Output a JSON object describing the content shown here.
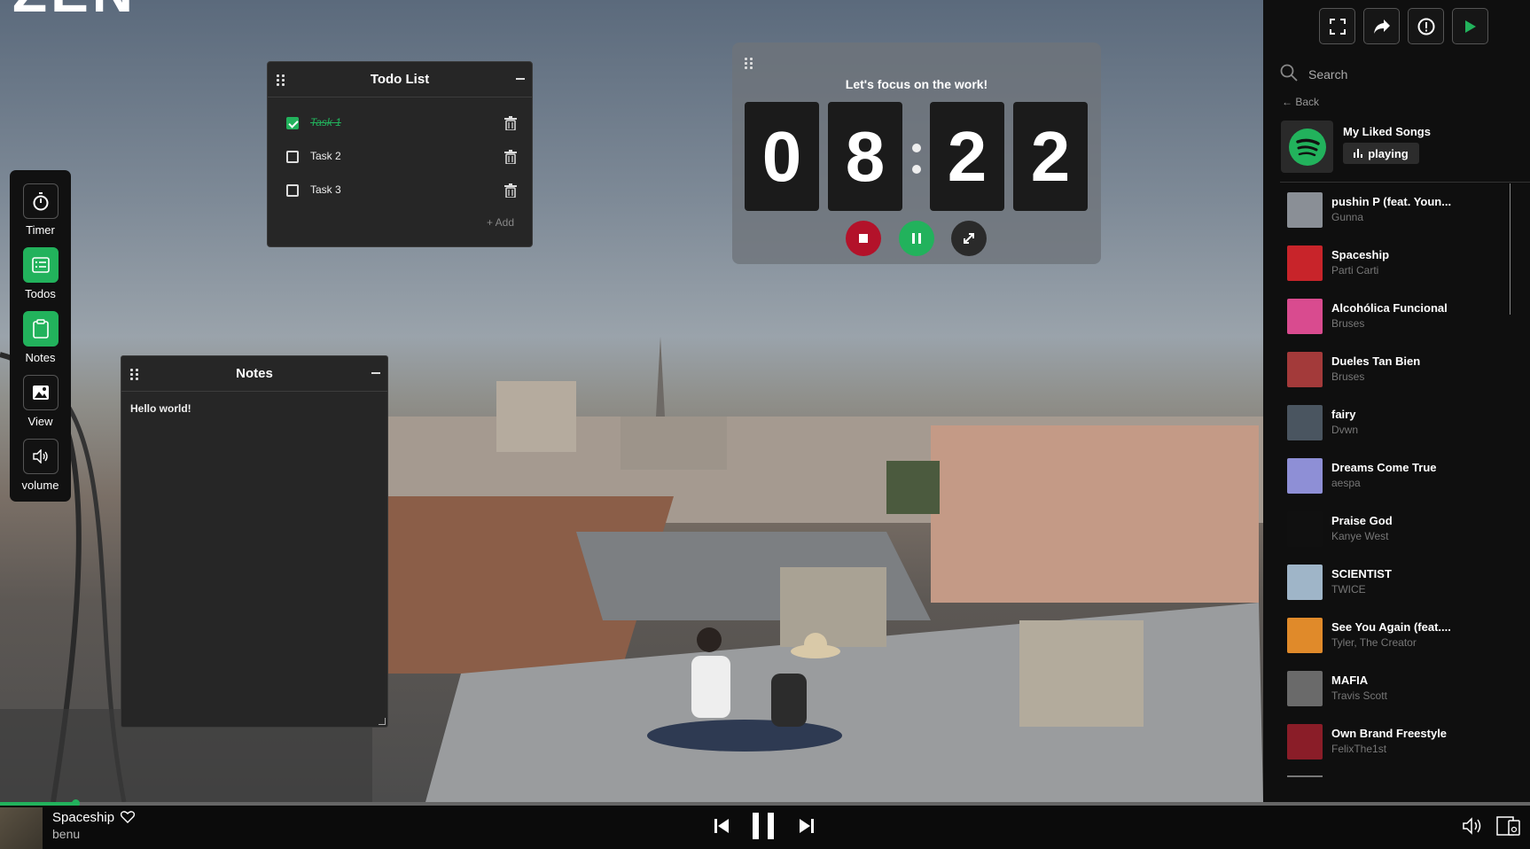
{
  "scene": {
    "big_title": "ZEN"
  },
  "dock": {
    "items": [
      {
        "label": "Timer",
        "icon": "stopwatch-icon"
      },
      {
        "label": "Todos",
        "icon": "checklist-icon"
      },
      {
        "label": "Notes",
        "icon": "clipboard-icon"
      },
      {
        "label": "View",
        "icon": "image-icon"
      },
      {
        "label": "volume",
        "icon": "speaker-icon"
      }
    ]
  },
  "todo": {
    "title": "Todo List",
    "tasks": [
      {
        "text": "Task 1",
        "done": true
      },
      {
        "text": "Task 2",
        "done": false
      },
      {
        "text": "Task 3",
        "done": false
      }
    ],
    "add_label": "+ Add"
  },
  "notes": {
    "title": "Notes",
    "content": "Hello world!"
  },
  "timer": {
    "title": "Let's focus on the work!",
    "digits": [
      "0",
      "8",
      "2",
      "2"
    ],
    "colors": {
      "stop": "#b3122a",
      "pause": "#22b25c",
      "expand": "#2a2a2a"
    }
  },
  "sidebar": {
    "search_placeholder": "Search",
    "back_label": "Back",
    "playlist": {
      "name": "My Liked Songs",
      "status": "playing"
    },
    "songs": [
      {
        "title": "pushin P (feat. Youn...",
        "artist": "Gunna",
        "cover": "#8a8f96"
      },
      {
        "title": "Spaceship",
        "artist": "Parti Carti",
        "cover": "#c8242a"
      },
      {
        "title": "Alcohólica Funcional",
        "artist": "Bruses",
        "cover": "#d94b8f"
      },
      {
        "title": "Dueles Tan Bien",
        "artist": "Bruses",
        "cover": "#a33a3a"
      },
      {
        "title": "fairy",
        "artist": "Dvwn",
        "cover": "#4a5560"
      },
      {
        "title": "Dreams Come True",
        "artist": "aespa",
        "cover": "#8e8fd6"
      },
      {
        "title": "Praise God",
        "artist": "Kanye West",
        "cover": "#101010"
      },
      {
        "title": "SCIENTIST",
        "artist": "TWICE",
        "cover": "#9fb5c8"
      },
      {
        "title": "See You Again (feat....",
        "artist": "Tyler, The Creator",
        "cover": "#e08a2a"
      },
      {
        "title": "MAFIA",
        "artist": "Travis Scott",
        "cover": "#6a6a6a"
      },
      {
        "title": "Own Brand Freestyle",
        "artist": "FelixThe1st",
        "cover": "#8a1d28"
      }
    ]
  },
  "player": {
    "title": "Spaceship",
    "artist": "benu",
    "progress_percent": 4.9
  },
  "colors": {
    "accent": "#22b25c",
    "panel": "#262626",
    "sidebar": "#0f0f0f"
  }
}
